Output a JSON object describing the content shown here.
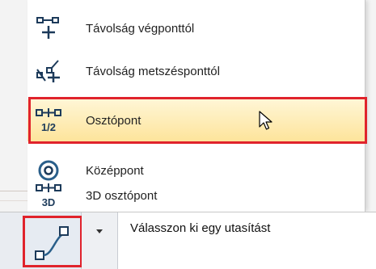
{
  "menu": {
    "items": [
      {
        "label": "Távolság végponttól",
        "icon": "distance-from-endpoint-icon"
      },
      {
        "label": "Távolság metszésponttól",
        "icon": "distance-from-intersection-icon"
      },
      {
        "label": "Osztópont",
        "icon": "divider-point-half-icon",
        "highlighted": true
      },
      {
        "label": "Középpont",
        "icon": "center-point-icon"
      },
      {
        "label": "3D osztópont",
        "icon": "divider-point-3d-icon"
      }
    ]
  },
  "toolbar": {
    "tool_icon": "line-segment-icon",
    "dropdown_icon": "caret-down-icon",
    "command_label": "Válasszon ki egy utasítást"
  },
  "colors": {
    "highlight_border": "#e0232c",
    "highlight_fill": "#fde49b",
    "icon_blue": "#2a5f8a",
    "icon_navy": "#1c3a5a"
  }
}
